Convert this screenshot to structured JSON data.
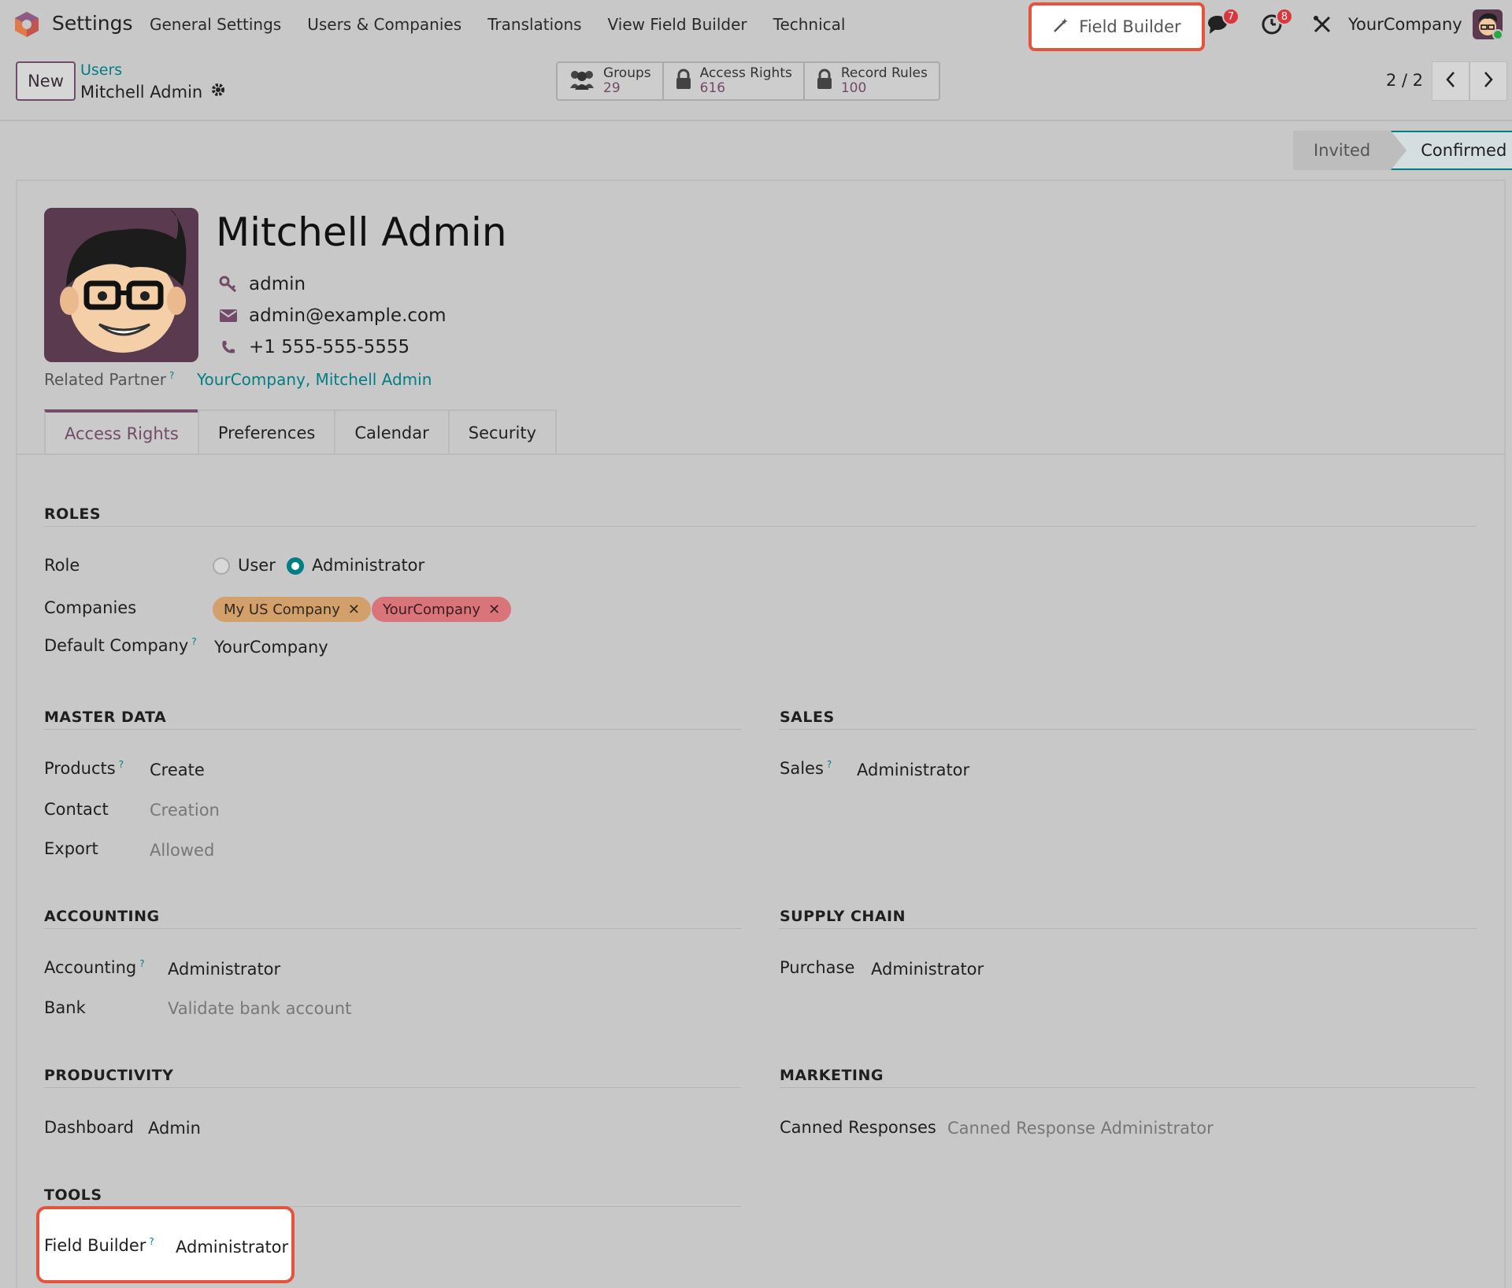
{
  "app": {
    "name": "Settings",
    "menu": [
      "General Settings",
      "Users & Companies",
      "Translations",
      "View Field Builder",
      "Technical"
    ]
  },
  "systray": {
    "field_builder_label": "Field Builder",
    "messages_count": "7",
    "activities_count": "8",
    "company": "YourCompany"
  },
  "control": {
    "new_label": "New",
    "breadcrumb_parent": "Users",
    "breadcrumb_current": "Mitchell Admin",
    "smart_buttons": [
      {
        "label": "Groups",
        "value": "29",
        "icon": "users-icon"
      },
      {
        "label": "Access Rights",
        "value": "616",
        "icon": "lock-icon"
      },
      {
        "label": "Record Rules",
        "value": "100",
        "icon": "lock-icon"
      }
    ],
    "pager": "2 / 2"
  },
  "status": {
    "invited": "Invited",
    "confirmed": "Confirmed"
  },
  "user": {
    "name": "Mitchell Admin",
    "login": "admin",
    "email": "admin@example.com",
    "phone": "+1 555-555-5555",
    "related_partner_label": "Related Partner",
    "related_partner_value": "YourCompany, Mitchell Admin"
  },
  "tabs": [
    "Access Rights",
    "Preferences",
    "Calendar",
    "Security"
  ],
  "roles": {
    "title": "ROLES",
    "role_label": "Role",
    "role_options": [
      "User",
      "Administrator"
    ],
    "role_selected": "Administrator",
    "companies_label": "Companies",
    "companies": [
      "My US Company",
      "YourCompany"
    ],
    "default_company_label": "Default Company",
    "default_company_value": "YourCompany"
  },
  "master_data": {
    "title": "MASTER DATA",
    "products_label": "Products",
    "products_value": "Create",
    "contact_label": "Contact",
    "contact_value": "Creation",
    "export_label": "Export",
    "export_value": "Allowed"
  },
  "sales": {
    "title": "SALES",
    "sales_label": "Sales",
    "sales_value": "Administrator"
  },
  "accounting": {
    "title": "ACCOUNTING",
    "accounting_label": "Accounting",
    "accounting_value": "Administrator",
    "bank_label": "Bank",
    "bank_value": "Validate bank account"
  },
  "supply_chain": {
    "title": "SUPPLY CHAIN",
    "purchase_label": "Purchase",
    "purchase_value": "Administrator"
  },
  "productivity": {
    "title": "PRODUCTIVITY",
    "dashboard_label": "Dashboard",
    "dashboard_value": "Admin"
  },
  "marketing": {
    "title": "MARKETING",
    "canned_label": "Canned Responses",
    "canned_value": "Canned Response Administrator"
  },
  "tools": {
    "title": "TOOLS",
    "field_builder_label": "Field Builder",
    "field_builder_value": "Administrator"
  },
  "colors": {
    "primary": "#714b67",
    "accent": "#017e84",
    "highlight": "#e5533d"
  }
}
